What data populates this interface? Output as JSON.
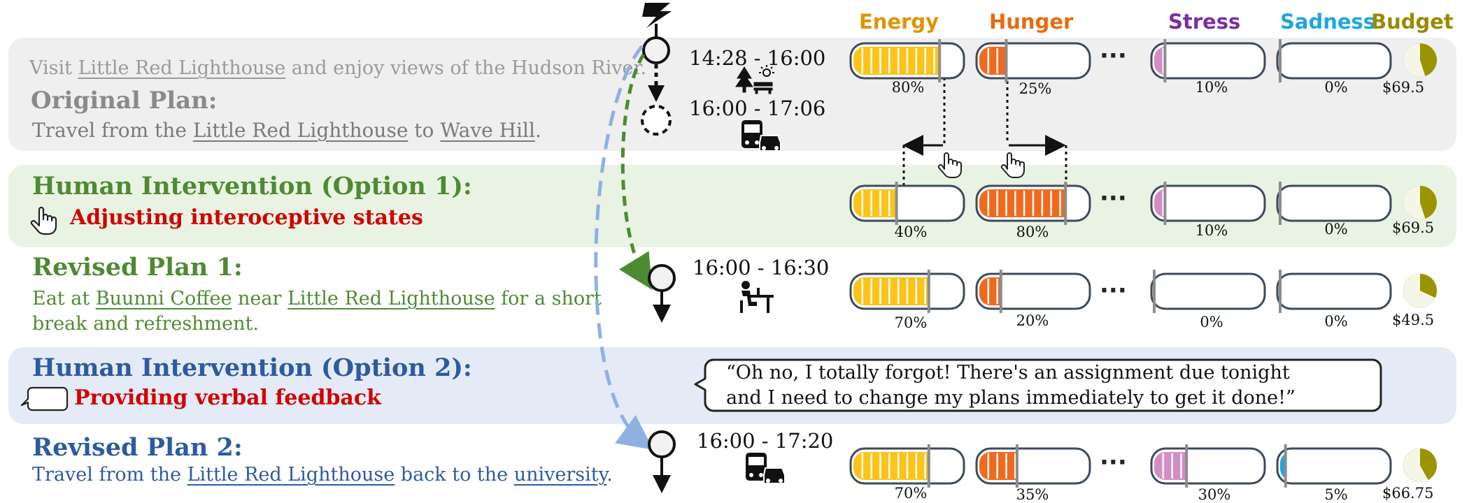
{
  "labels": {
    "energy": "Energy",
    "hunger": "Hunger",
    "stress": "Stress",
    "sadness": "Sadness",
    "budget": "Budget"
  },
  "colors": {
    "energy": "#fcc419",
    "hunger": "#f06a1e",
    "stress": "#d48cc8",
    "sadness": "#1fa6e0",
    "budget": "#9a9400",
    "original_text": "#8a8a8a",
    "option1_text": "#4e8a33",
    "option2_text": "#2e5a9e",
    "red": "#d00000"
  },
  "original": {
    "pre_line": [
      "Visit ",
      "Little Red Lighthouse",
      " and enjoy views of the Hudson River."
    ],
    "title": "Original Plan:",
    "line": [
      "Travel from the ",
      "Little Red Lighthouse",
      " to ",
      "Wave Hill",
      "."
    ],
    "time1": "14:28 - 16:00",
    "time2": "16:00 - 17:06",
    "values": {
      "energy": 80,
      "hunger": 25,
      "stress": 10,
      "sadness": 0
    },
    "pct_labels": {
      "energy": "80%",
      "hunger": "25%",
      "stress": "10%",
      "sadness": "0%"
    },
    "budget": "$69.5",
    "budget_fraction": 0.45
  },
  "option1": {
    "title": "Human Intervention (Option 1):",
    "subtitle": "Adjusting interoceptive states",
    "values": {
      "energy": 40,
      "hunger": 80,
      "stress": 10,
      "sadness": 0
    },
    "pct_labels": {
      "energy": "40%",
      "hunger": "80%",
      "stress": "10%",
      "sadness": "0%"
    },
    "budget": "$69.5",
    "budget_fraction": 0.45
  },
  "revised1": {
    "title": "Revised Plan 1:",
    "line1": [
      "Eat at ",
      "Buunni Coffee",
      " near ",
      "Little Red Lighthouse",
      " for a short"
    ],
    "line2": "break and refreshment.",
    "time": "16:00 - 16:30",
    "values": {
      "energy": 70,
      "hunger": 20,
      "stress": 0,
      "sadness": 0
    },
    "pct_labels": {
      "energy": "70%",
      "hunger": "20%",
      "stress": "0%",
      "sadness": "0%"
    },
    "budget": "$49.5",
    "budget_fraction": 0.32
  },
  "option2": {
    "title": "Human Intervention (Option 2):",
    "subtitle": "Providing verbal feedback",
    "quote_line1": "“Oh no, I totally forgot! There's an assignment due tonight",
    "quote_line2": "and I need to change my plans immediately to get it done!”"
  },
  "revised2": {
    "title": "Revised Plan 2:",
    "line": [
      "Travel from the ",
      "Little Red Lighthouse",
      " back to the ",
      "university",
      "."
    ],
    "time": "16:00 - 17:20",
    "values": {
      "energy": 70,
      "hunger": 35,
      "stress": 30,
      "sadness": 5
    },
    "pct_labels": {
      "energy": "70%",
      "hunger": "35%",
      "stress": "30%",
      "sadness": "5%"
    },
    "budget": "$66.75",
    "budget_fraction": 0.42
  },
  "ellipsis": "···"
}
